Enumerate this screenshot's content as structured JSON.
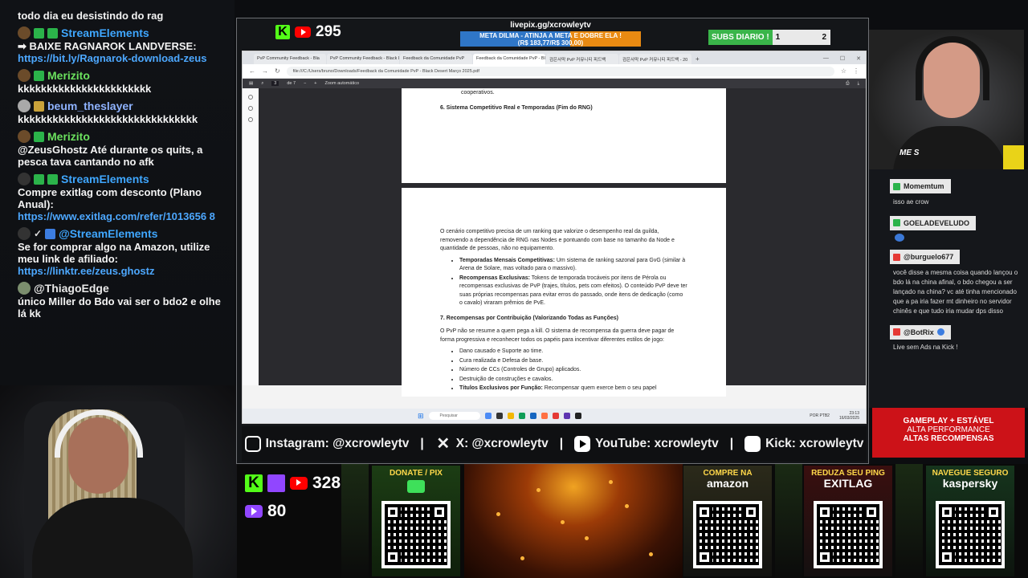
{
  "chat": {
    "messages": [
      {
        "kind": "text",
        "text": "todo dia eu desistindo do rag"
      },
      {
        "kind": "user",
        "user": "StreamElements",
        "color": "blue"
      },
      {
        "kind": "text",
        "text": "➡ BAIXE RAGNAROK LANDVERSE:"
      },
      {
        "kind": "link",
        "text": "https://bit.ly/Ragnarok-download-zeus"
      },
      {
        "kind": "user",
        "user": "Merizito",
        "color": "green"
      },
      {
        "kind": "text",
        "text": "kkkkkkkkkkkkkkkkkkkkkkk"
      },
      {
        "kind": "user",
        "user": "beum_theslayer",
        "color": "lilac"
      },
      {
        "kind": "text",
        "text": "kkkkkkkkkkkkkkkkkkkkkkkkkkkkkkk"
      },
      {
        "kind": "user",
        "user": "Merizito",
        "color": "green"
      },
      {
        "kind": "text",
        "text": "@ZeusGhostz Até durante os quits, a pesca tava cantando no afk"
      },
      {
        "kind": "user",
        "user": "StreamElements",
        "color": "blue"
      },
      {
        "kind": "text",
        "text": "Compre exitlag com desconto (Plano Anual):"
      },
      {
        "kind": "link",
        "text": "https://www.exitlag.com/refer/1013656 8"
      },
      {
        "kind": "user",
        "user": "@StreamElements",
        "color": "blue"
      },
      {
        "kind": "text",
        "text": "Se for comprar algo na Amazon, utilize meu link de afiliado:"
      },
      {
        "kind": "link",
        "text": "https://linktr.ee/zeus.ghostz"
      },
      {
        "kind": "user",
        "user": "@ThiagoEdge",
        "color": "white"
      },
      {
        "kind": "text",
        "text": "único Miller do Bdo vai ser o bdo2 e olhe lá kk"
      }
    ]
  },
  "overlay": {
    "top_count": "295",
    "livepix_url": "livepix.gg/xcrowleytv",
    "meta_line1": "META DILMA - ATINJA A META E DOBRE ELA !",
    "meta_line2": "(R$ 183,77/R$ 300,00)",
    "meta_progress": 0.61,
    "subs_label": "SUBS DIARIO !",
    "subs_current": "1",
    "subs_goal": "2",
    "socials": {
      "instagram": "Instagram: @xcrowleytv",
      "x": "X: @xcrowleytv",
      "youtube": "YouTube: xcrowleytv",
      "kick": "Kick: xcrowleytv"
    },
    "bottom_count_1": "328",
    "bottom_count_2": "80",
    "cards": [
      {
        "title": "DONATE / PIX",
        "brand": ""
      },
      {
        "title": "COMPRE NA",
        "brand": "amazon"
      },
      {
        "title": "REDUZA SEU PING",
        "brand": "EXITLAG"
      },
      {
        "title": "NAVEGUE SEGURO",
        "brand": "kaspersky"
      }
    ],
    "cam_caption": "ME S",
    "gameplay_ad": {
      "line1": "GAMEPLAY + ESTÁVEL",
      "line2": "ALTA PERFORMANCE",
      "line3": "ALTAS RECOMPENSAS"
    }
  },
  "browser": {
    "tabs": [
      "PvP Community Feedback - Bla",
      "PvP Community Feedback - Black D",
      "Feedback da Comunidade PvP",
      "Feedback da Comunidade PvP - Bla",
      "검은사막 PvP 커뮤니티 피드백",
      "검은사막 PvP 커뮤니티 피드백 - 20"
    ],
    "active_tab": 3,
    "url": "file:///C:/Users/bruno/Downloads/Feedback da Comunidade PvP - Black Desert Março 2025.pdf",
    "page_current": "3",
    "page_total": "de 7",
    "zoom": "Zoom automático",
    "search_placeholder": "Pesquisar",
    "clock_time": "23:13",
    "clock_date": "16/03/2025",
    "lang": "POR PTB2"
  },
  "pdf": {
    "p1_tail": "cooperativos.",
    "section6": "6. Sistema Competitivo Real e Temporadas (Fim do RNG)",
    "para6": "O cenário competitivo precisa de um ranking que valorize o desempenho real da guilda, removendo a dependência de RNG nas Nodes e pontuando com base no tamanho da Node e quantidade de pessoas, não no equipamento.",
    "bullets6": [
      {
        "b": "Temporadas Mensais Competitivas:",
        "t": " Um sistema de ranking sazonal para GvG (similar à Arena de Solare, mas voltado para o massivo)."
      },
      {
        "b": "Recompensas Exclusivas:",
        "t": " Tokens de temporada trocáveis por itens de Pérola ou recompensas exclusivas de PvP (trajes, títulos, pets com efeitos). O conteúdo PvP deve ter suas próprias recompensas para evitar erros do passado, onde itens de dedicação (como o cavalo) viraram prêmios de PvE."
      }
    ],
    "section7": "7. Recompensas por Contribuição (Valorizando Todas as Funções)",
    "para7": "O PvP não se resume a quem pega a kill. O sistema de recompensa da guerra deve pagar de forma progressiva e reconhecer todos os papéis para incentivar diferentes estilos de jogo:",
    "bullets7": [
      "Dano causado e Suporte ao time.",
      "Cura realizada e Defesa de base.",
      "Número de CCs (Controles de Grupo) aplicados.",
      "Destruição de construções e cavalos."
    ],
    "last_bullet_b": "Títulos Exclusivos por Função:",
    "last_bullet_t": " Recompensar quem exerce bem o seu papel"
  },
  "right_chat": [
    {
      "user": "Momemtum",
      "badge": "green",
      "msg": "isso ae crow"
    },
    {
      "user": "GOELADEVELUDO",
      "badge": "green",
      "msg": ""
    },
    {
      "user": "@burguelo677",
      "badge": "red",
      "msg": "você disse a mesma coisa quando lançou o bdo lá na china afinal, o bdo chegou a ser lançado na china? vc até tinha mencionado que a pa iria fazer mt dinheiro no servidor chinês e que tudo iria mudar dps disso"
    },
    {
      "user": "@BotRix",
      "badge": "red",
      "msg": "Live sem Ads na Kick !"
    }
  ]
}
